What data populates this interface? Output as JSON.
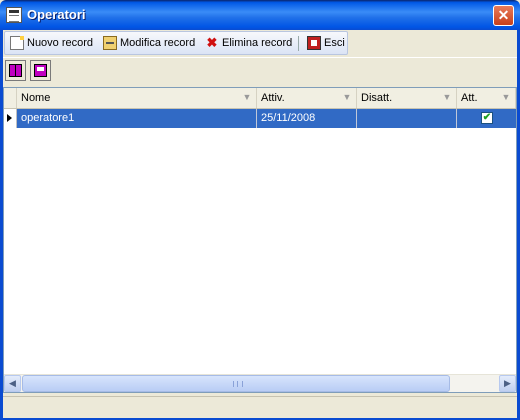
{
  "window": {
    "title": "Operatori",
    "close_glyph": "✕"
  },
  "toolbar": {
    "items": [
      {
        "label": "Nuovo record",
        "icon": "new-record-icon"
      },
      {
        "label": "Modifica record",
        "icon": "edit-record-icon"
      },
      {
        "label": "Elimina record",
        "icon": "delete-record-icon"
      },
      {
        "label": "Esci",
        "icon": "exit-icon"
      }
    ],
    "delete_glyph": "✖"
  },
  "secondary_toolbar": {
    "buttons": [
      {
        "icon": "book-icon"
      },
      {
        "icon": "print-icon"
      }
    ]
  },
  "grid": {
    "columns": [
      "Nome",
      "Attiv.",
      "Disatt.",
      "Att."
    ],
    "dropdown_glyph": "▼",
    "rows": [
      {
        "nome": "operatore1",
        "attiv": "25/11/2008",
        "disatt": "",
        "att": true,
        "selected": true
      }
    ],
    "check_glyph": "✔"
  },
  "scrollbar": {
    "left_glyph": "◀",
    "right_glyph": "▶"
  },
  "colors": {
    "titlebar": "#0058e6",
    "selection": "#316ac5",
    "window_bg": "#ece9d8"
  }
}
